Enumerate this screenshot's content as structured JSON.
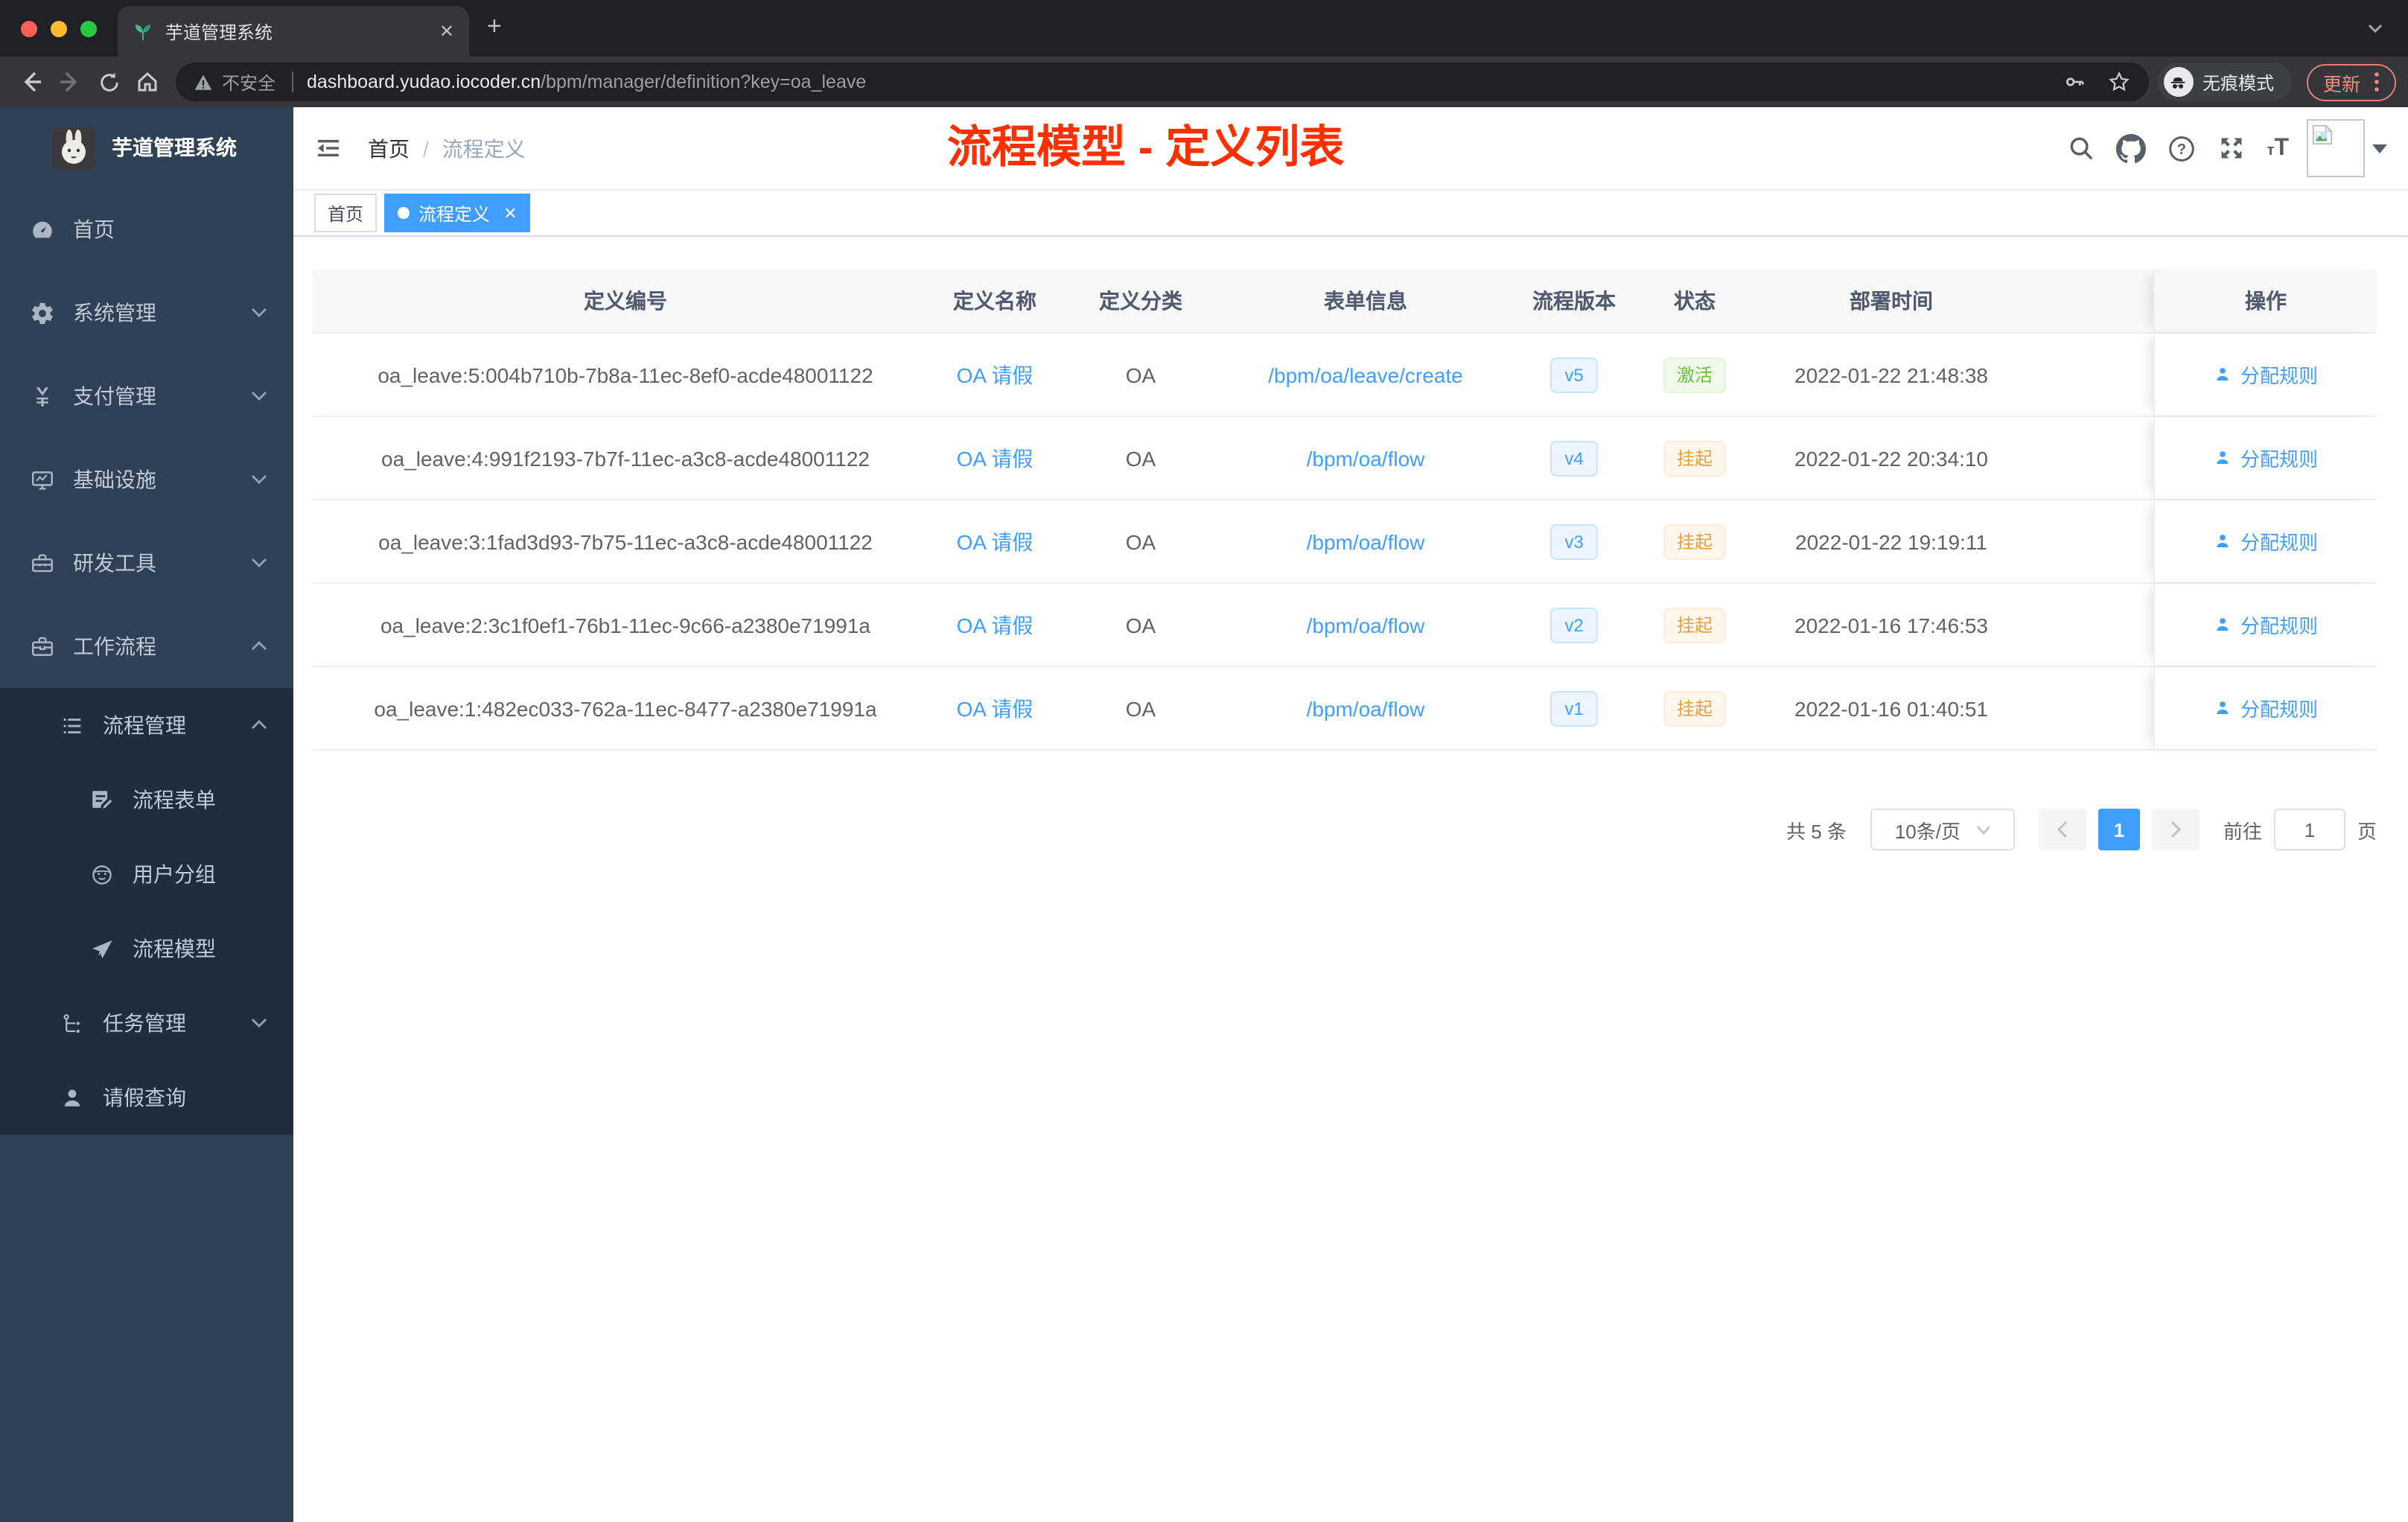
{
  "browser": {
    "tab_title": "芋道管理系统",
    "security_label": "不安全",
    "url_host": "dashboard.yudao.iocoder.cn",
    "url_path": "/bpm/manager/definition?key=oa_leave",
    "incognito_label": "无痕模式",
    "update_label": "更新"
  },
  "sidebar": {
    "logo_title": "芋道管理系统",
    "items": [
      {
        "name": "home",
        "label": "首页",
        "icon": "dashboard-icon",
        "level": 1,
        "arrow": null,
        "sub": false
      },
      {
        "name": "system-management",
        "label": "系统管理",
        "icon": "gear-icon",
        "level": 1,
        "arrow": "down",
        "sub": false
      },
      {
        "name": "payment-management",
        "label": "支付管理",
        "icon": "yen-icon",
        "level": 1,
        "arrow": "down",
        "sub": false
      },
      {
        "name": "infrastructure",
        "label": "基础设施",
        "icon": "monitor-icon",
        "level": 1,
        "arrow": "down",
        "sub": false
      },
      {
        "name": "dev-tools",
        "label": "研发工具",
        "icon": "toolbox-icon",
        "level": 1,
        "arrow": "down",
        "sub": false
      },
      {
        "name": "workflow",
        "label": "工作流程",
        "icon": "briefcase-icon",
        "level": 1,
        "arrow": "up",
        "sub": false
      },
      {
        "name": "process-management",
        "label": "流程管理",
        "icon": "process-list-icon",
        "level": 2,
        "arrow": "up",
        "sub": true
      },
      {
        "name": "process-form",
        "label": "流程表单",
        "icon": "form-edit-icon",
        "level": 3,
        "arrow": null,
        "sub": true
      },
      {
        "name": "user-group",
        "label": "用户分组",
        "icon": "user-group-icon",
        "level": 3,
        "arrow": null,
        "sub": true
      },
      {
        "name": "process-model",
        "label": "流程模型",
        "icon": "paper-plane-icon",
        "level": 3,
        "arrow": null,
        "sub": true
      },
      {
        "name": "task-management",
        "label": "任务管理",
        "icon": "task-flow-icon",
        "level": 2,
        "arrow": "down",
        "sub": true
      },
      {
        "name": "leave-query",
        "label": "请假查询",
        "icon": "user-icon",
        "level": 2,
        "arrow": null,
        "sub": true
      }
    ]
  },
  "navbar": {
    "breadcrumb_home": "首页",
    "breadcrumb_separator": "/",
    "breadcrumb_current": "流程定义",
    "overlay_title": "流程模型 - 定义列表",
    "right_icons": [
      "search-icon",
      "github-icon",
      "question-icon",
      "fullscreen-icon",
      "font-size-icon",
      "avatar",
      "caret-down-icon"
    ]
  },
  "tags": [
    {
      "name": "home",
      "label": "首页",
      "active": false
    },
    {
      "name": "process-definition",
      "label": "流程定义",
      "active": true
    }
  ],
  "table": {
    "columns": [
      {
        "key": "id",
        "label": "定义编号"
      },
      {
        "key": "name",
        "label": "定义名称"
      },
      {
        "key": "category",
        "label": "定义分类"
      },
      {
        "key": "form",
        "label": "表单信息"
      },
      {
        "key": "version",
        "label": "流程版本"
      },
      {
        "key": "status",
        "label": "状态"
      },
      {
        "key": "time",
        "label": "部署时间"
      },
      {
        "key": "action",
        "label": "操作"
      }
    ],
    "rows": [
      {
        "id": "oa_leave:5:004b710b-7b8a-11ec-8ef0-acde48001122",
        "name": "OA 请假",
        "category": "OA",
        "form": "/bpm/oa/leave/create",
        "version": "v5",
        "status": "激活",
        "status_type": "success",
        "time": "2022-01-22 21:48:38",
        "action": "分配规则"
      },
      {
        "id": "oa_leave:4:991f2193-7b7f-11ec-a3c8-acde48001122",
        "name": "OA 请假",
        "category": "OA",
        "form": "/bpm/oa/flow",
        "version": "v4",
        "status": "挂起",
        "status_type": "warning",
        "time": "2022-01-22 20:34:10",
        "action": "分配规则"
      },
      {
        "id": "oa_leave:3:1fad3d93-7b75-11ec-a3c8-acde48001122",
        "name": "OA 请假",
        "category": "OA",
        "form": "/bpm/oa/flow",
        "version": "v3",
        "status": "挂起",
        "status_type": "warning",
        "time": "2022-01-22 19:19:11",
        "action": "分配规则"
      },
      {
        "id": "oa_leave:2:3c1f0ef1-76b1-11ec-9c66-a2380e71991a",
        "name": "OA 请假",
        "category": "OA",
        "form": "/bpm/oa/flow",
        "version": "v2",
        "status": "挂起",
        "status_type": "warning",
        "time": "2022-01-16 17:46:53",
        "action": "分配规则"
      },
      {
        "id": "oa_leave:1:482ec033-762a-11ec-8477-a2380e71991a",
        "name": "OA 请假",
        "category": "OA",
        "form": "/bpm/oa/flow",
        "version": "v1",
        "status": "挂起",
        "status_type": "warning",
        "time": "2022-01-16 01:40:51",
        "action": "分配规则"
      }
    ]
  },
  "pagination": {
    "total": "共 5 条",
    "page_size": "10条/页",
    "current": "1",
    "goto_label": "前往",
    "goto_value": "1",
    "goto_suffix": "页"
  },
  "colors": {
    "accent": "#409eff",
    "overlay_title_red": "#ff3000",
    "status_success": "#67c23a",
    "status_warning": "#e6a23c",
    "sidebar_bg": "#304156",
    "sidebar_submenu_bg": "#1f2d3d",
    "traffic_lights": [
      "#ff5f57",
      "#febc2e",
      "#28c840"
    ]
  }
}
